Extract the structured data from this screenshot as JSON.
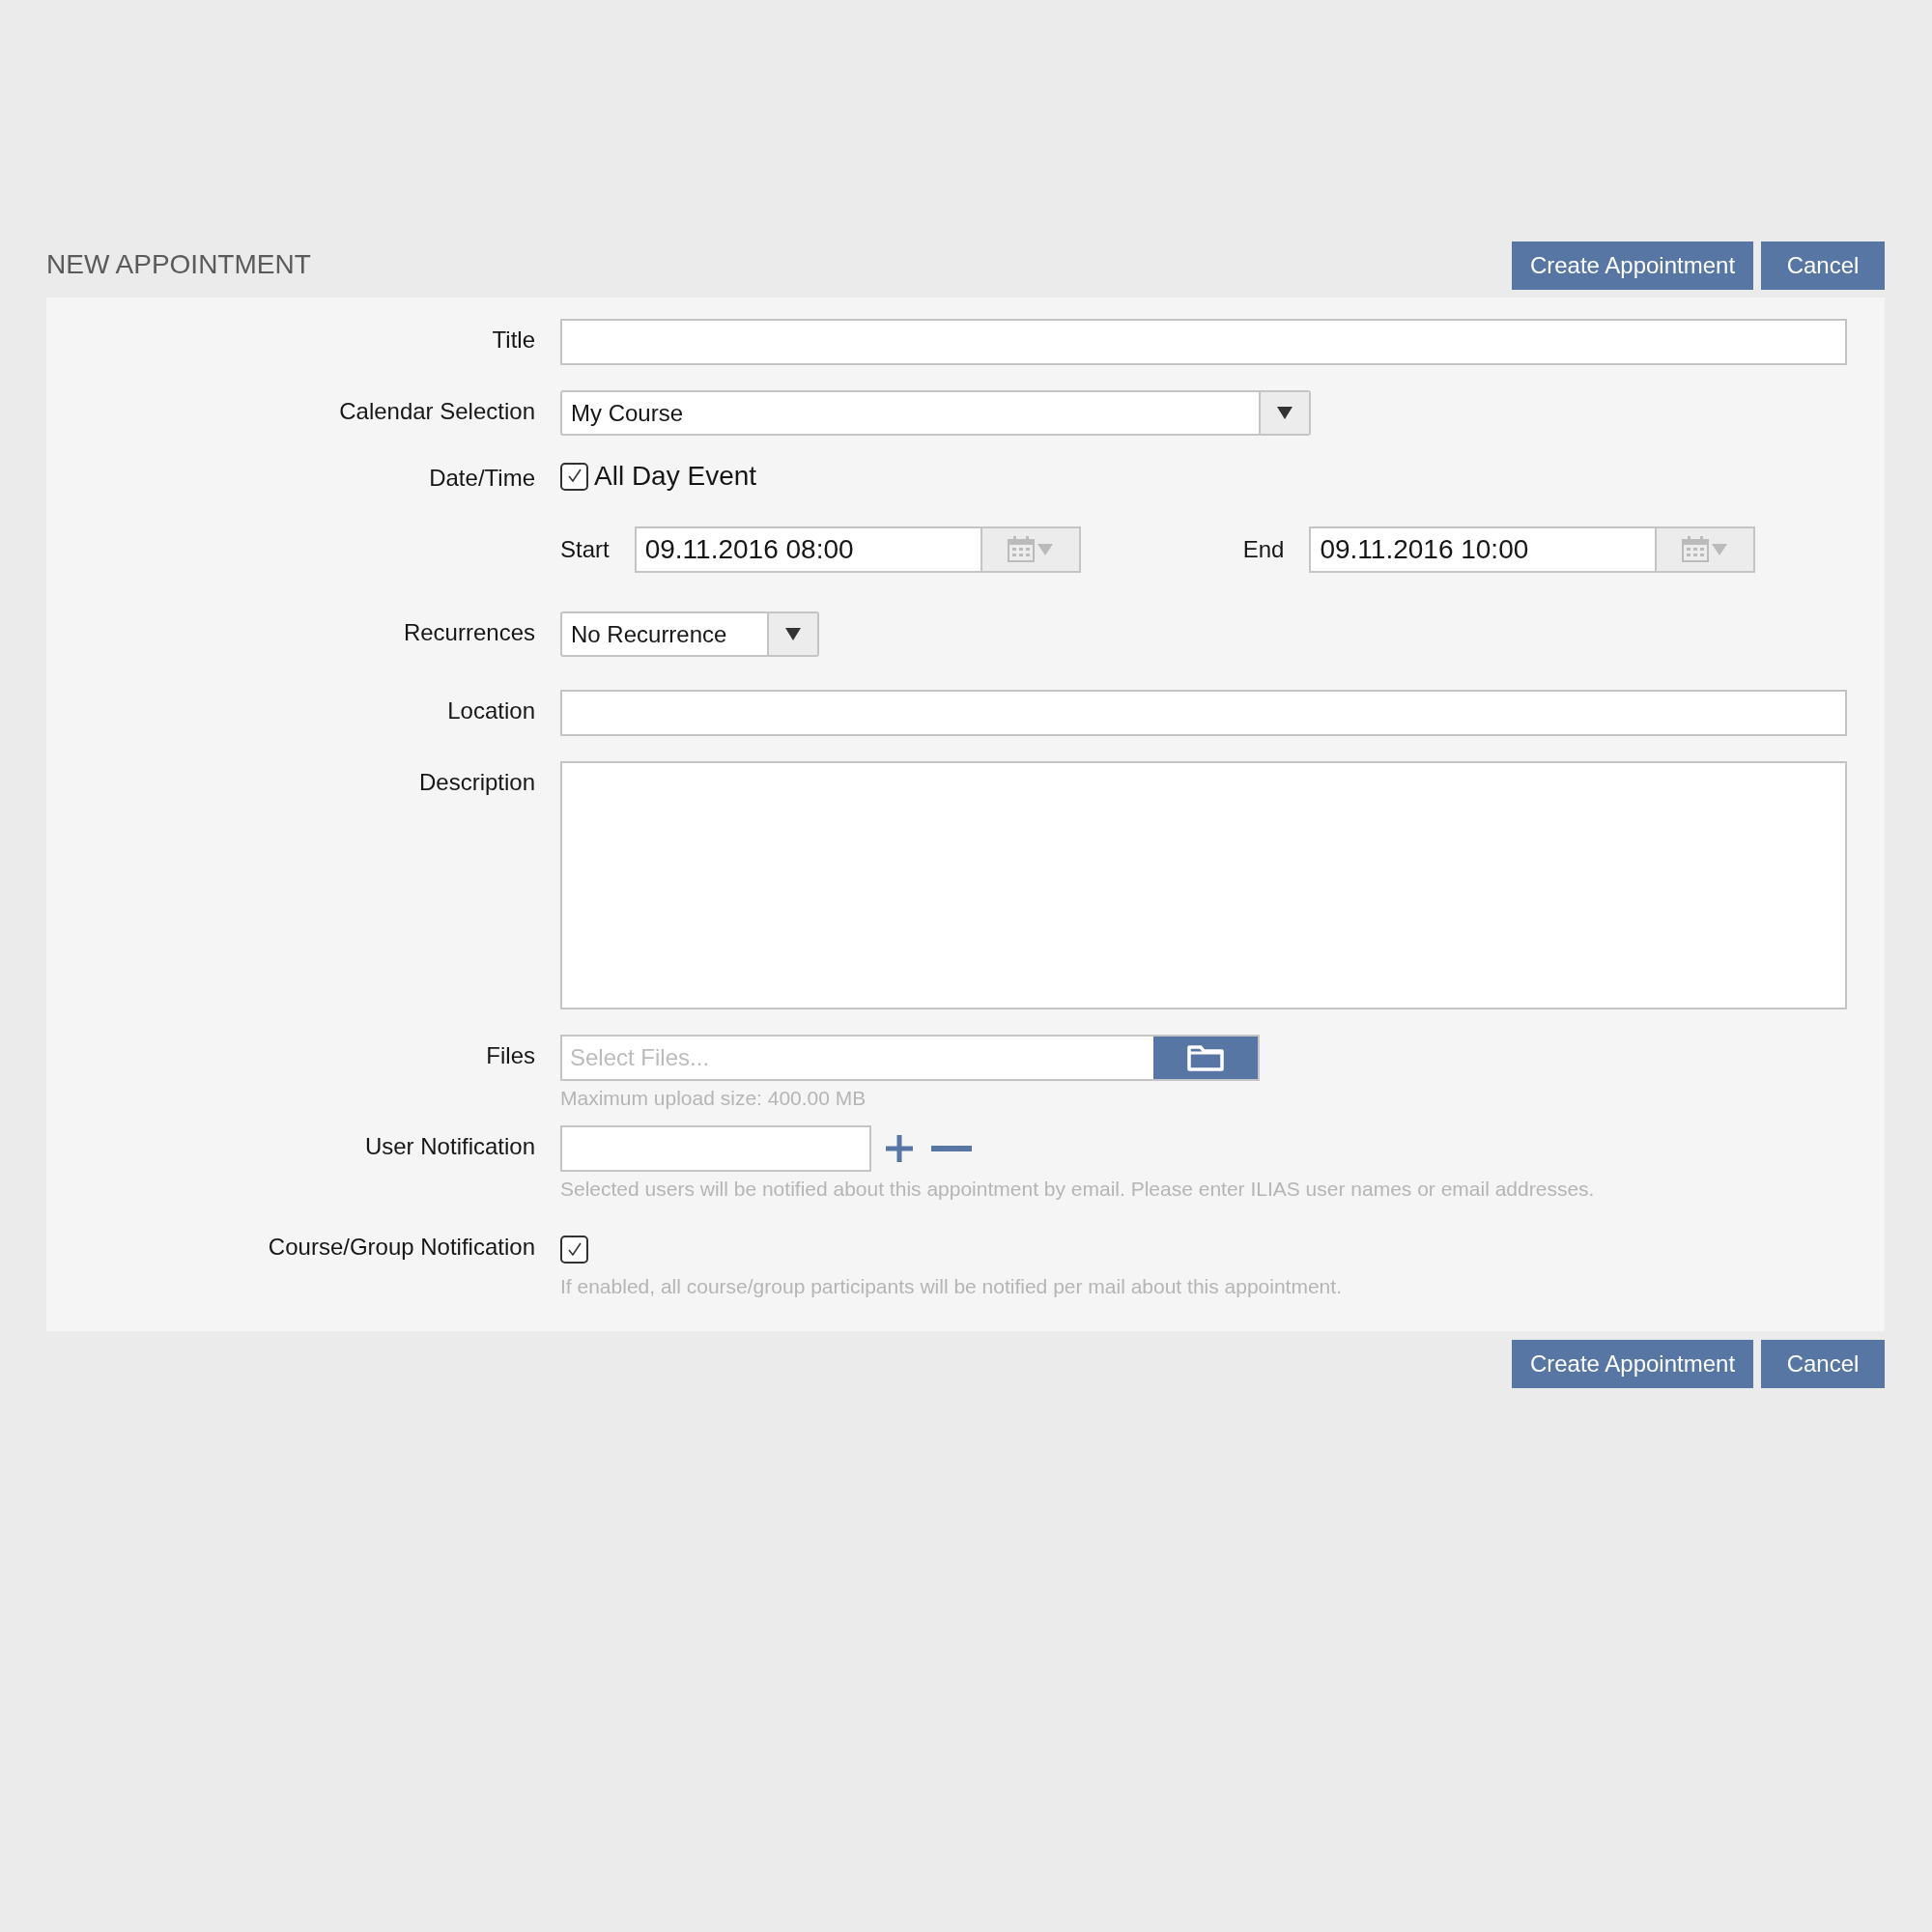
{
  "header": {
    "title": "NEW APPOINTMENT"
  },
  "top_buttons": [
    "Create Appointment",
    "Cancel"
  ],
  "fields": [
    {
      "kind": "text",
      "label": "Title"
    },
    {
      "kind": "select",
      "label": "Calendar Selection",
      "value": "My Course"
    },
    {
      "kind": "datetime",
      "label": "Date/Time",
      "checkbox": {
        "label": "All Day Event",
        "checked": true
      },
      "start": {
        "label": "Start",
        "value": "09.11.2016 08:00"
      },
      "end": {
        "label": "End",
        "value": "09.11.2016 10:00"
      }
    },
    {
      "kind": "select",
      "label": "Recurrences",
      "value": "No Recurrence"
    },
    {
      "kind": "text",
      "label": "Location"
    },
    {
      "kind": "textarea",
      "label": "Description"
    },
    {
      "kind": "file",
      "label": "Files",
      "placeholder": "Select Files...",
      "hint": "Maximum upload size: 400.00 MB"
    },
    {
      "kind": "users",
      "label": "User Notification",
      "hint": "Selected users will be notified about this appointment by email. Please enter ILIAS user names or email addresses."
    },
    {
      "kind": "checkbox",
      "label": "Course/Group Notification",
      "checked": true,
      "hint": "If enabled, all course/group participants will be notified per mail about this appointment."
    }
  ],
  "bottom_buttons": [
    "Create Appointment",
    "Cancel"
  ]
}
